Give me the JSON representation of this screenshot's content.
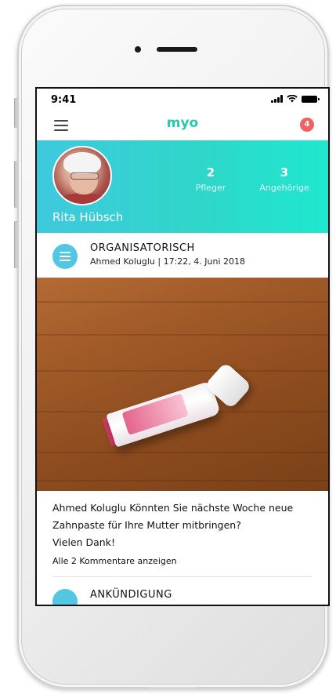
{
  "status_bar": {
    "time": "9:41"
  },
  "nav": {
    "brand": "myo",
    "notification_count": "4"
  },
  "profile": {
    "name": "Rita Hübsch",
    "stats": [
      {
        "value": "2",
        "label": "Pfleger"
      },
      {
        "value": "3",
        "label": "Angehörige"
      }
    ]
  },
  "post": {
    "category": "ORGANISATORISCH",
    "meta": "Ahmed Koluglu | 17:22, 4. Juni 2018",
    "author": "Ahmed Koluglu",
    "text": "Könnten Sie nächste Woche neue Zahnpaste für Ihre Mutter mitbringen?",
    "thanks": "Vielen Dank!",
    "comments_link": "Alle 2 Kommentare anzeigen"
  },
  "next_post": {
    "category": "ANKÜNDIGUNG"
  },
  "colors": {
    "accent": "#25c9b0",
    "hero_start": "#3fc9df",
    "hero_end": "#1fe8cf",
    "badge": "#f06262",
    "category_icon": "#53c6e4"
  }
}
